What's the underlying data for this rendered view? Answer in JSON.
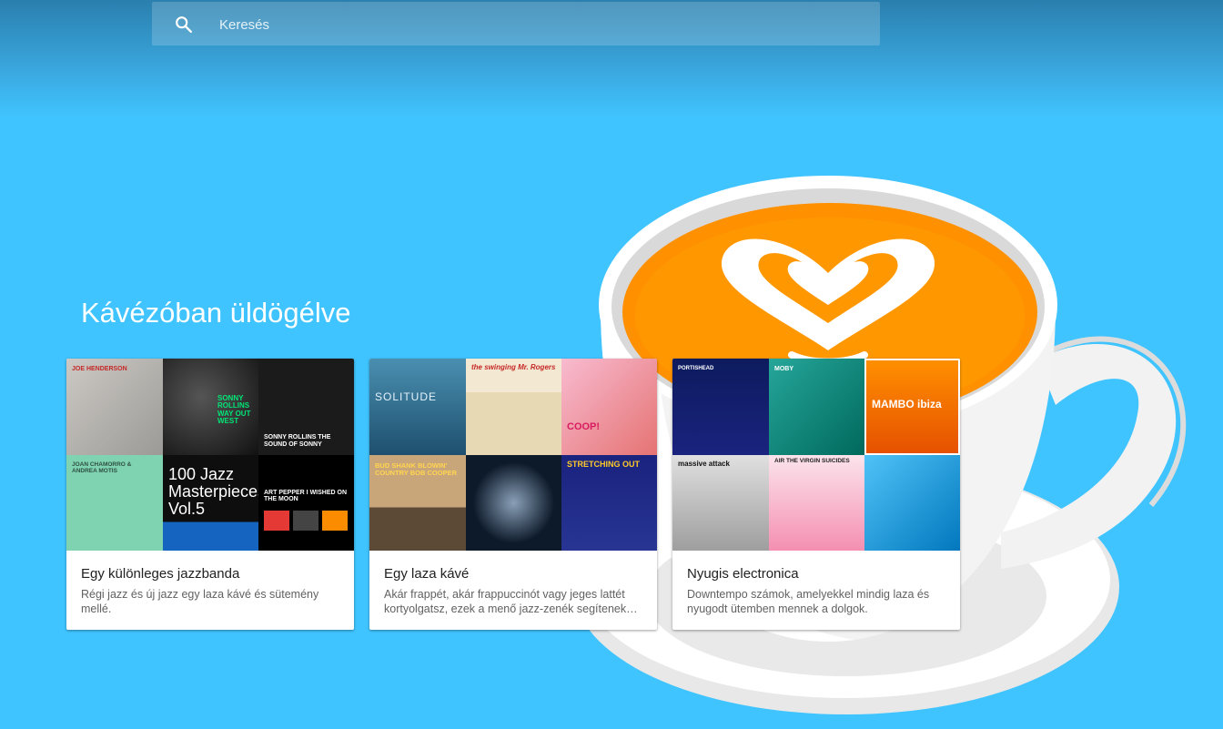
{
  "search": {
    "placeholder": "Keresés"
  },
  "section": {
    "title": "Kávézóban üldögélve"
  },
  "colors": {
    "background": "#40c4ff",
    "top_gradient": "#2a7fae",
    "coffee": "#ff9800",
    "cup": "#ffffff"
  },
  "cards": [
    {
      "title": "Egy különleges jazzbanda",
      "description": "Régi jazz és új jazz egy laza kávé és sütemény mellé.",
      "covers": [
        {
          "text": "JOE HENDERSON"
        },
        {
          "text": "SONNY ROLLINS WAY OUT WEST"
        },
        {
          "text": "SONNY ROLLINS THE SOUND OF SONNY"
        },
        {
          "text": "JOAN CHAMORRO & ANDREA MOTIS"
        },
        {
          "text": "100 Jazz Masterpieces Vol.5"
        },
        {
          "text": "ART PEPPER I WISHED ON THE MOON"
        }
      ]
    },
    {
      "title": "Egy laza kávé",
      "description": "Akár frappét, akár frappuccinót vagy jeges lattét kortyolgatsz, ezek a menő jazz-zenék segítenek…",
      "covers": [
        {
          "text": "SOLITUDE"
        },
        {
          "text": "the swinging Mr. Rogers"
        },
        {
          "text": "COOP!"
        },
        {
          "text": "BUD SHANK BLOWIN' COUNTRY BOB COOPER"
        },
        {
          "text": ""
        },
        {
          "text": "STRETCHING OUT"
        }
      ]
    },
    {
      "title": "Nyugis electronica",
      "description": "Downtempo számok, amelyekkel mindig laza és nyugodt ütemben mennek a dolgok.",
      "covers": [
        {
          "text": "PORTISHEAD"
        },
        {
          "text": "MOBY"
        },
        {
          "text": "MAMBO ibiza"
        },
        {
          "text": "massive attack"
        },
        {
          "text": "AIR THE VIRGIN SUICIDES"
        },
        {
          "text": ""
        }
      ]
    }
  ]
}
